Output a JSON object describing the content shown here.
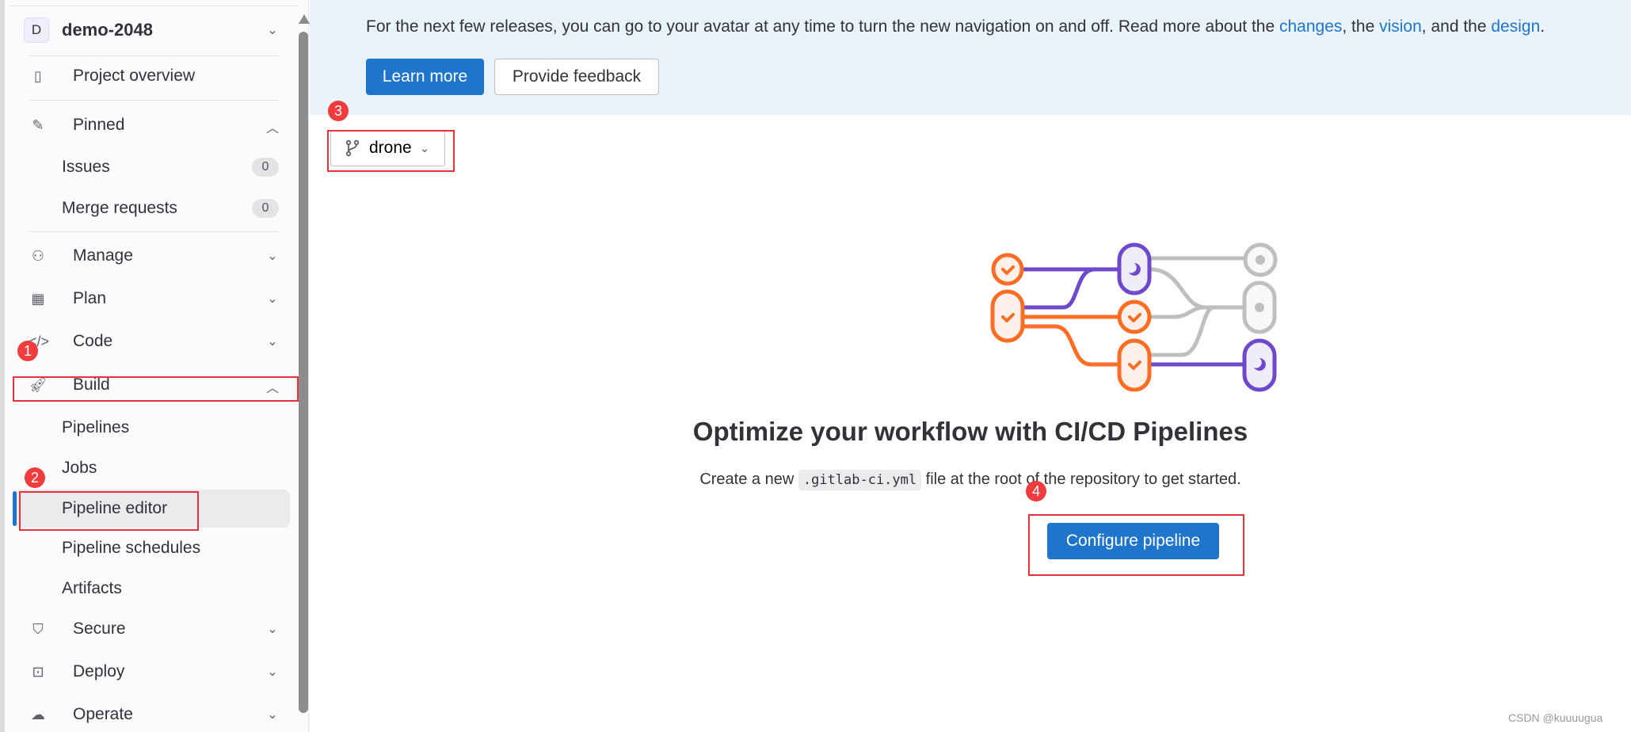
{
  "sidebar": {
    "project": {
      "initial": "D",
      "name": "demo-2048"
    },
    "items": [
      {
        "label": "Project overview",
        "icon": "project-icon"
      },
      {
        "label": "Pinned",
        "icon": "pin-icon"
      },
      {
        "label": "Issues",
        "count": "0"
      },
      {
        "label": "Merge requests",
        "count": "0"
      },
      {
        "label": "Manage",
        "icon": "users-icon"
      },
      {
        "label": "Plan",
        "icon": "calendar-icon"
      },
      {
        "label": "Code",
        "icon": "code-icon"
      },
      {
        "label": "Build",
        "icon": "rocket-icon"
      },
      {
        "label": "Pipelines"
      },
      {
        "label": "Jobs"
      },
      {
        "label": "Pipeline editor",
        "active": true
      },
      {
        "label": "Pipeline schedules"
      },
      {
        "label": "Artifacts"
      },
      {
        "label": "Secure",
        "icon": "shield-icon"
      },
      {
        "label": "Deploy",
        "icon": "deploy-icon"
      },
      {
        "label": "Operate",
        "icon": "cloud-gear-icon"
      }
    ]
  },
  "banner": {
    "text_before": "For the next few releases, you can go to your avatar at any time to turn the new navigation on and off. Read more about the ",
    "link_changes": "changes",
    "sep1": ", the ",
    "link_vision": "vision",
    "sep2": ", and the ",
    "link_design": "design",
    "end": ".",
    "learn_more": "Learn more",
    "provide_feedback": "Provide feedback"
  },
  "branch": {
    "name": "drone"
  },
  "empty_state": {
    "title": "Optimize your workflow with CI/CD Pipelines",
    "desc_before": "Create a new ",
    "filename": ".gitlab-ci.yml",
    "desc_after": " file at the root of the repository to get started.",
    "button": "Configure pipeline"
  },
  "annotations": [
    "1",
    "2",
    "3",
    "4"
  ],
  "watermark": "CSDN @kuuuugua",
  "colors": {
    "accent": "#1f75cb",
    "annotation": "#e8323a",
    "orange": "#fc6d26",
    "purple": "#6e49cb"
  }
}
